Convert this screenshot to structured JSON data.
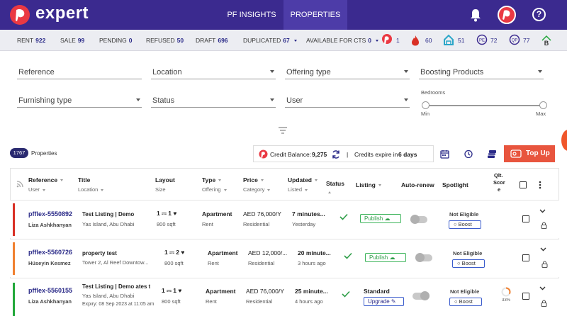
{
  "app": {
    "logo_text": "expert"
  },
  "nav": {
    "tabs": [
      {
        "label": "PF INSIGHTS"
      },
      {
        "label": "PROPERTIES"
      }
    ]
  },
  "stats": {
    "rent_label": "RENT",
    "rent_value": "922",
    "sale_label": "SALE",
    "sale_value": "99",
    "pending_label": "PENDING",
    "pending_value": "0",
    "refused_label": "REFUSED",
    "refused_value": "50",
    "draft_label": "DRAFT",
    "draft_value": "696",
    "duplicated_label": "DUPLICATED",
    "duplicated_value": "67",
    "cts_label": "AVAILABLE FOR CTS",
    "cts_value": "0",
    "icon_counts": [
      "1",
      "60",
      "51",
      "72",
      "77"
    ]
  },
  "filters": {
    "reference": "Reference",
    "location": "Location",
    "offering_type": "Offering type",
    "boosting_products": "Boosting Products",
    "furnishing_type": "Furnishing type",
    "status": "Status",
    "user": "User",
    "bedrooms_label": "Bedrooms",
    "min_label": "Min",
    "max_label": "Max",
    "bedrooms_min_frac": 0,
    "bedrooms_max_frac": 1
  },
  "summary": {
    "count": "1767",
    "count_label": "Properties",
    "credit_label": "Credit Balance:",
    "credit_value": "9,275",
    "sep": "|",
    "expire_text": "Credits expire in",
    "expire_value": "6 days",
    "topup_label": "Top Up"
  },
  "table": {
    "headers": {
      "reference": "Reference",
      "user": "User",
      "title": "Title",
      "location": "Location",
      "layout": "Layout",
      "size": "Size",
      "type": "Type",
      "offering": "Offering",
      "price": "Price",
      "category": "Category",
      "updated": "Updated",
      "listed": "Listed",
      "status": "Status",
      "listing": "Listing",
      "autorenew": "Auto-renew",
      "spotlight": "Spotlight",
      "qlt_1": "Qlt.",
      "qlt_2": "Scor",
      "qlt_3": "e"
    },
    "rows": [
      {
        "ref": "pfflex-5550892",
        "user": "Liza Ashkhanyan",
        "title": "Test Listing | Demo",
        "location": "Yas Island, Abu Dhabi",
        "beds": "1",
        "baths": "1",
        "size": "800 sqft",
        "type": "Apartment",
        "offering": "Rent",
        "price": "AED 76,000/Y",
        "category": "Residential",
        "updated": "7 minutes...",
        "listed": "Yesterday",
        "listing": "Publish",
        "spotlight": "Not Eligible",
        "boost": "Boost",
        "accent": "#d93025"
      },
      {
        "ref": "pfflex-5560726",
        "user": "Hüseyin Kesmez",
        "title": "property test",
        "location": "Tower 2, Al Reef Downtow...",
        "beds": "1",
        "baths": "2",
        "size": "800 sqft",
        "type": "Apartment",
        "offering": "Rent",
        "price": "AED 12,000/...",
        "category": "Residential",
        "updated": "20 minute...",
        "listed": "3 hours ago",
        "listing": "Publish",
        "spotlight": "Not Eligible",
        "boost": "Boost",
        "accent": "#f08030"
      },
      {
        "ref": "pfflex-5560155",
        "user": "Liza Ashkhanyan",
        "title": "Test Listing | Demo ates t",
        "location": "Yas Island, Abu Dhabi",
        "expiry": "Expiry: 08 Sep 2023 at 11:05 am",
        "beds": "1",
        "baths": "1",
        "size": "800 sqft",
        "type": "Apartment",
        "offering": "Rent",
        "price": "AED 76,000/Y",
        "category": "Residential",
        "updated": "25 minute...",
        "listed": "4 hours ago",
        "listing": "Standard",
        "upgrade": "Upgrade",
        "spotlight": "Not Eligible",
        "boost": "Boost",
        "quality": "33%",
        "quality_frac": 0.33,
        "accent": "#22a83a"
      }
    ]
  }
}
